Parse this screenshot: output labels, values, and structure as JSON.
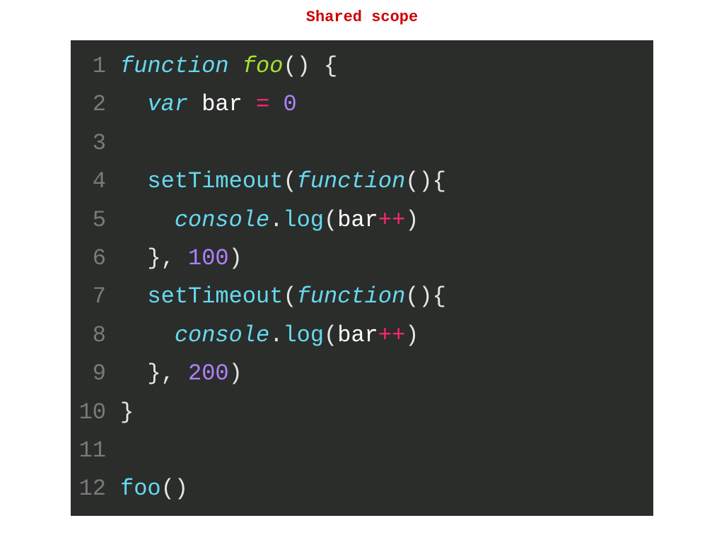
{
  "title": "Shared scope",
  "lines": {
    "l1": "1",
    "l2": "2",
    "l3": "3",
    "l4": "4",
    "l5": "5",
    "l6": "6",
    "l7": "7",
    "l8": "8",
    "l9": "9",
    "l10": "10",
    "l11": "11",
    "l12": "12"
  },
  "tokens": {
    "function": "function",
    "foo": "foo",
    "var": "var",
    "bar": "bar",
    "eq": "=",
    "zero": "0",
    "setTimeout": "setTimeout",
    "console": "console",
    "log": "log",
    "plusplus": "++",
    "hundred": "100",
    "twohundred": "200",
    "op_paren": "(",
    "cl_paren": ")",
    "op_brace": "{",
    "cl_brace": "}",
    "comma": ",",
    "dot": "."
  }
}
